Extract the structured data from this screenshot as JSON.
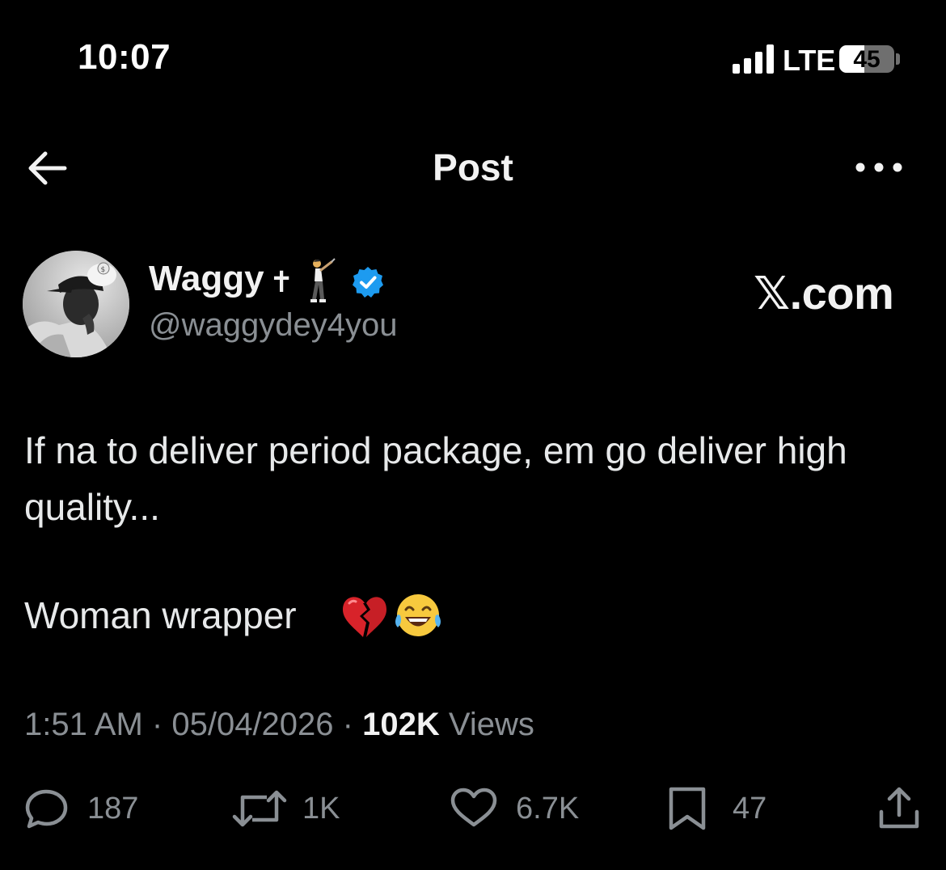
{
  "status_bar": {
    "time": "10:07",
    "network": "LTE",
    "battery": "45"
  },
  "header": {
    "title": "Post"
  },
  "author": {
    "name": "Waggy",
    "name_symbol": "✝",
    "handle": "@waggydey4you",
    "source_watermark": "𝕏.com"
  },
  "post": {
    "text_line1": "If na to deliver period package, em go deliver high quality...",
    "text_line2": "Woman wrapper",
    "emojis": [
      "broken-heart",
      "tears-of-joy"
    ]
  },
  "meta": {
    "time": "1:51 AM",
    "date": "05/04/2026",
    "views_count": "102K",
    "views_label": "Views",
    "separator": "·"
  },
  "actions": {
    "replies": "187",
    "reposts": "1K",
    "likes": "6.7K",
    "bookmarks": "47"
  },
  "colors": {
    "background": "#000000",
    "text": "#e7e9ea",
    "secondary": "#8a8f94",
    "verified": "#1d9bf0"
  }
}
